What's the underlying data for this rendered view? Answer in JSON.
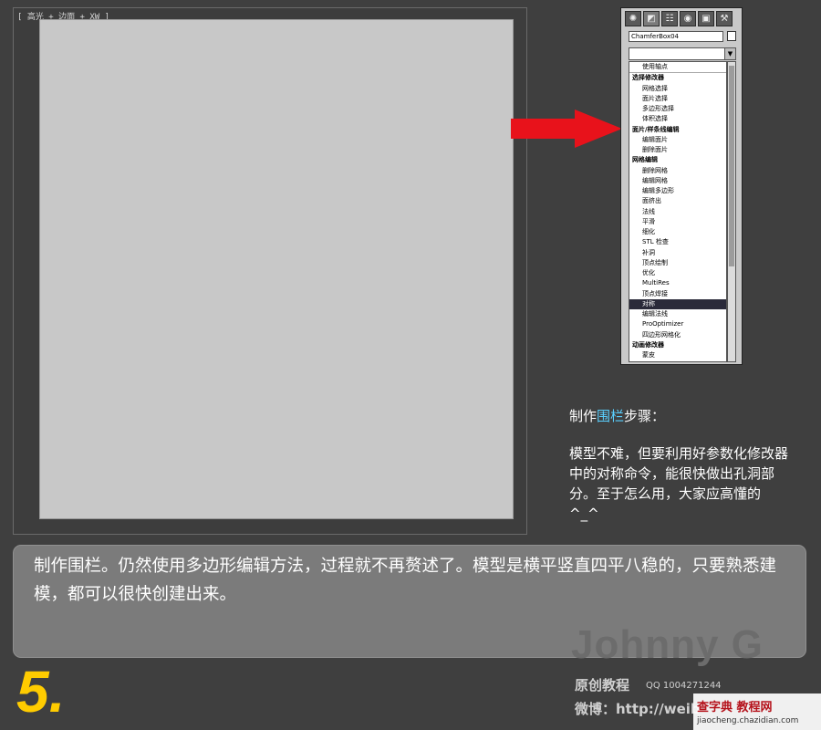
{
  "viewport": {
    "label": "[ 高光 + 边面 + XW ]"
  },
  "command_panel": {
    "tabs": [
      {
        "icon": "create-icon",
        "glyph": "✺"
      },
      {
        "icon": "modify-icon",
        "glyph": "◩"
      },
      {
        "icon": "hierarchy-icon",
        "glyph": "☷"
      },
      {
        "icon": "motion-icon",
        "glyph": "◉"
      },
      {
        "icon": "display-icon",
        "glyph": "▣"
      },
      {
        "icon": "utilities-icon",
        "glyph": "⚒"
      }
    ],
    "object_name": "ChamferBox04",
    "modifier_list": [
      {
        "label": "使用轴点",
        "kind": "first"
      },
      {
        "label": "选择修改器",
        "kind": "header"
      },
      {
        "label": "网格选择",
        "kind": "item"
      },
      {
        "label": "面片选择",
        "kind": "item"
      },
      {
        "label": "多边形选择",
        "kind": "item"
      },
      {
        "label": "体积选择",
        "kind": "item"
      },
      {
        "label": "面片/样条线编辑",
        "kind": "header"
      },
      {
        "label": "编辑面片",
        "kind": "item"
      },
      {
        "label": "删除面片",
        "kind": "item"
      },
      {
        "label": "网格编辑",
        "kind": "header"
      },
      {
        "label": "删除网格",
        "kind": "item"
      },
      {
        "label": "编辑网格",
        "kind": "item"
      },
      {
        "label": "编辑多边形",
        "kind": "item"
      },
      {
        "label": "面挤出",
        "kind": "item"
      },
      {
        "label": "法线",
        "kind": "item"
      },
      {
        "label": "平滑",
        "kind": "item"
      },
      {
        "label": "细化",
        "kind": "item"
      },
      {
        "label": "STL 检查",
        "kind": "item"
      },
      {
        "label": "补洞",
        "kind": "item"
      },
      {
        "label": "顶点绘制",
        "kind": "item"
      },
      {
        "label": "优化",
        "kind": "item"
      },
      {
        "label": "MultiRes",
        "kind": "item"
      },
      {
        "label": "顶点焊接",
        "kind": "item"
      },
      {
        "label": "对称",
        "kind": "item sel"
      },
      {
        "label": "编辑法线",
        "kind": "item"
      },
      {
        "label": "ProOptimizer",
        "kind": "item"
      },
      {
        "label": "四边形网格化",
        "kind": "item"
      },
      {
        "label": "动画修改器",
        "kind": "header"
      },
      {
        "label": "蒙皮",
        "kind": "item"
      }
    ]
  },
  "side_caption": {
    "title_prefix": "制作",
    "title_highlight": "围栏",
    "title_suffix": "步骤：",
    "body": "模型不难，但要利用好参数化修改器中的对称命令，能很快做出孔洞部分。至于怎么用，大家应高懂的^_^"
  },
  "caption": {
    "text": "制作围栏。仍然使用多边形编辑方法，过程就不再赘述了。模型是横平竖直四平八稳的，只要熟悉建模，都可以很快创建出来。"
  },
  "step_number": "5.",
  "signature": {
    "name": "Johnny G",
    "sub": "原创教程",
    "qq": "QQ 1004271244",
    "weibo": "微博：http://weib"
  },
  "watermark": {
    "main_a": "查字典",
    "main_b": "教程网",
    "url": "jiaocheng.chazidian.com"
  },
  "colors": {
    "highlight": "#5ad0ff",
    "step": "#ffcc00",
    "arrow": "#e8121b"
  }
}
